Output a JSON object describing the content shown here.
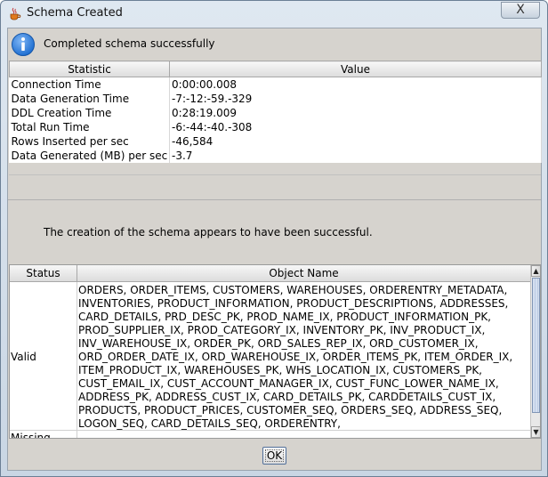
{
  "window": {
    "title": "Schema Created",
    "close_label": "X"
  },
  "header": {
    "message": "Completed schema successfully"
  },
  "stats": {
    "columns": [
      "Statistic",
      "Value"
    ],
    "rows": [
      {
        "statistic": "Connection Time",
        "value": "0:00:00.008"
      },
      {
        "statistic": "Data Generation Time",
        "value": "-7:-12:-59.-329"
      },
      {
        "statistic": "DDL Creation Time",
        "value": "0:28:19.009"
      },
      {
        "statistic": "Total Run Time",
        "value": "-6:-44:-40.-308"
      },
      {
        "statistic": "Rows Inserted per sec",
        "value": "-46,584"
      },
      {
        "statistic": "Data Generated (MB) per sec",
        "value": "-3.7"
      }
    ]
  },
  "result_message": "The creation of the schema appears to have been successful.",
  "objects": {
    "columns": [
      "Status",
      "Object Name"
    ],
    "valid_label": "Valid",
    "missing_label": "Missing",
    "valid_lines": [
      "ORDERS, ORDER_ITEMS, CUSTOMERS, WAREHOUSES, ORDERENTRY_METADATA,",
      "INVENTORIES, PRODUCT_INFORMATION, PRODUCT_DESCRIPTIONS, ADDRESSES,",
      "CARD_DETAILS, PRD_DESC_PK, PROD_NAME_IX, PRODUCT_INFORMATION_PK,",
      "PROD_SUPPLIER_IX, PROD_CATEGORY_IX, INVENTORY_PK, INV_PRODUCT_IX,",
      "INV_WAREHOUSE_IX, ORDER_PK, ORD_SALES_REP_IX, ORD_CUSTOMER_IX,",
      "ORD_ORDER_DATE_IX, ORD_WAREHOUSE_IX, ORDER_ITEMS_PK, ITEM_ORDER_IX,",
      "ITEM_PRODUCT_IX, WAREHOUSES_PK, WHS_LOCATION_IX, CUSTOMERS_PK,",
      "CUST_EMAIL_IX, CUST_ACCOUNT_MANAGER_IX, CUST_FUNC_LOWER_NAME_IX,",
      "ADDRESS_PK, ADDRESS_CUST_IX, CARD_DETAILS_PK, CARDDETAILS_CUST_IX,",
      "PRODUCTS, PRODUCT_PRICES, CUSTOMER_SEQ, ORDERS_SEQ, ADDRESS_SEQ,",
      "LOGON_SEQ, CARD_DETAILS_SEQ, ORDERENTRY,"
    ]
  },
  "buttons": {
    "ok_label": "OK"
  },
  "icons": {
    "title": "java-cup-icon",
    "info": "info-icon",
    "scroll_up": "arrow-up-icon",
    "scroll_down": "arrow-down-icon"
  },
  "colors": {
    "info_blue": "#1f6fd1",
    "panel_gray": "#d6d3ce"
  }
}
